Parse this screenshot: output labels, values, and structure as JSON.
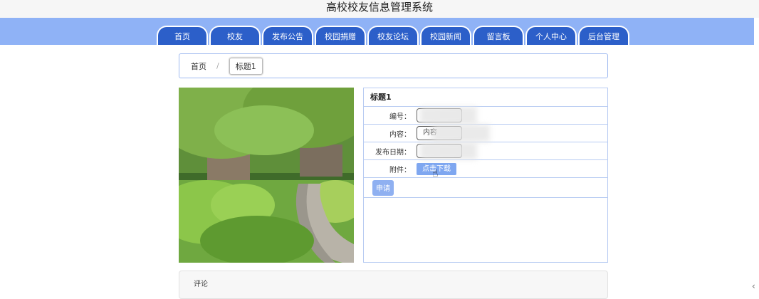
{
  "site": {
    "title": "高校校友信息管理系统"
  },
  "nav": {
    "items": [
      "首页",
      "校友",
      "发布公告",
      "校园捐赠",
      "校友论坛",
      "校园新闻",
      "留言板",
      "个人中心",
      "后台管理"
    ]
  },
  "breadcrumb": {
    "home": "首页",
    "separator": "/",
    "current": "标题1"
  },
  "detail": {
    "title": "标题1",
    "fields": [
      {
        "label": "编号：",
        "value": ""
      },
      {
        "label": "内容：",
        "value": "内容"
      },
      {
        "label": "发布日期：",
        "value": ""
      }
    ],
    "attachment_label": "附件：",
    "download_label": "点击下载",
    "apply_label": "申请"
  },
  "comment": {
    "label": "评论"
  },
  "icons": {
    "cursor": "hand-pointer-icon",
    "side": "chevron-left-icon"
  },
  "colors": {
    "nav_bg": "#8fb2f6",
    "nav_item": "#2c5fc9",
    "border": "#b7cbf2",
    "button": "#7fa7f0"
  }
}
